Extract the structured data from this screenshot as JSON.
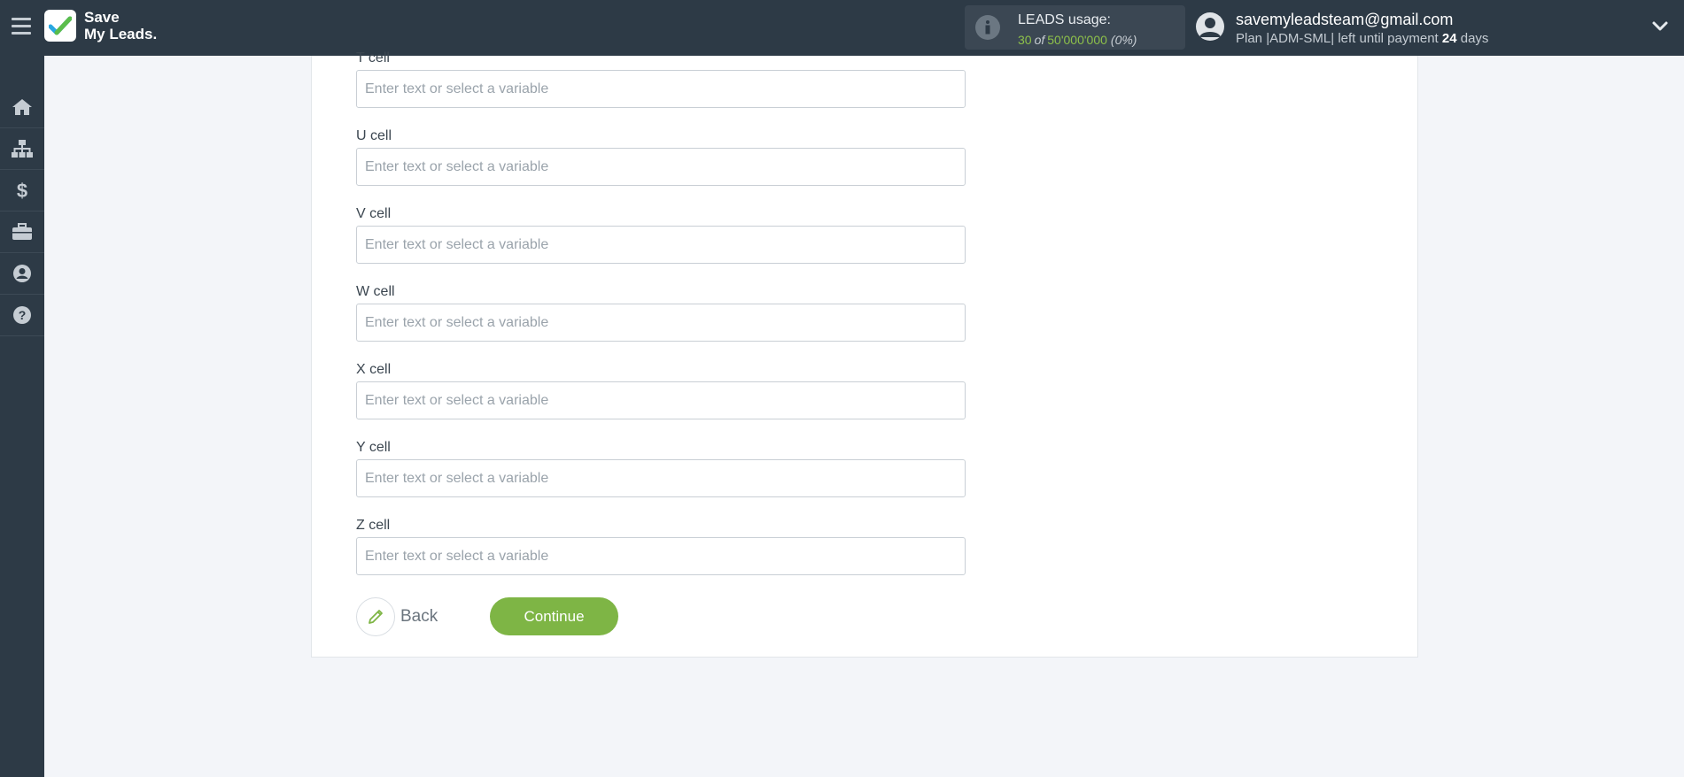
{
  "header": {
    "logo_line1": "Save",
    "logo_line2": "My Leads.",
    "usage_title": "LEADS usage:",
    "usage_used": "30",
    "usage_of": "of",
    "usage_limit": "50'000'000",
    "usage_percent": "(0%)",
    "user_email": "savemyleadsteam@gmail.com",
    "plan_prefix": "Plan |ADM-SML| left until payment",
    "plan_days": "24",
    "plan_suffix": "days"
  },
  "sidebar": {
    "items": [
      {
        "icon": "home-icon"
      },
      {
        "icon": "sitemap-icon"
      },
      {
        "icon": "dollar-icon"
      },
      {
        "icon": "briefcase-icon"
      },
      {
        "icon": "user-circle-icon"
      },
      {
        "icon": "question-circle-icon"
      }
    ]
  },
  "form": {
    "fields": [
      {
        "label": "T cell",
        "value": "",
        "placeholder": "Enter text or select a variable"
      },
      {
        "label": "U cell",
        "value": "",
        "placeholder": "Enter text or select a variable"
      },
      {
        "label": "V cell",
        "value": "",
        "placeholder": "Enter text or select a variable"
      },
      {
        "label": "W cell",
        "value": "",
        "placeholder": "Enter text or select a variable"
      },
      {
        "label": "X cell",
        "value": "",
        "placeholder": "Enter text or select a variable"
      },
      {
        "label": "Y cell",
        "value": "",
        "placeholder": "Enter text or select a variable"
      },
      {
        "label": "Z cell",
        "value": "",
        "placeholder": "Enter text or select a variable"
      }
    ],
    "back_label": "Back",
    "continue_label": "Continue"
  },
  "colors": {
    "accent_green": "#7eb545",
    "header_bg": "#2d3a46",
    "page_bg": "#f3f5f9"
  }
}
